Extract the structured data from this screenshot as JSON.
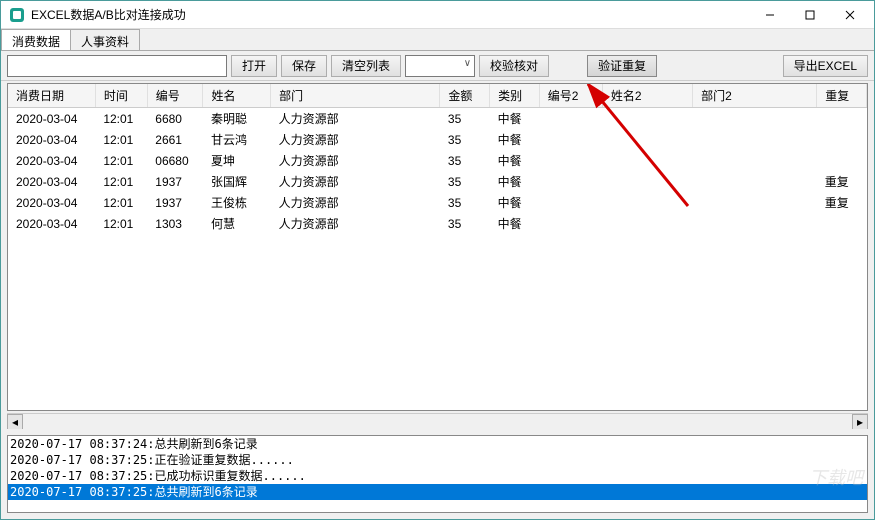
{
  "window": {
    "title": "EXCEL数据A/B比对连接成功"
  },
  "tabs": [
    {
      "label": "消费数据",
      "active": true
    },
    {
      "label": "人事资料",
      "active": false
    }
  ],
  "toolbar": {
    "open": "打开",
    "save": "保存",
    "clear_list": "清空列表",
    "combo_arrow": "∨",
    "check": "校验核对",
    "verify_dup": "验证重复",
    "export": "导出EXCEL"
  },
  "table": {
    "headers": [
      "消费日期",
      "时间",
      "编号",
      "姓名",
      "部门",
      "金额",
      "类别",
      "编号2",
      "姓名2",
      "部门2",
      "重复"
    ],
    "rows": [
      [
        "2020-03-04",
        "12:01",
        "6680",
        "秦明聪",
        "人力资源部",
        "35",
        "中餐",
        "",
        "",
        "",
        ""
      ],
      [
        "2020-03-04",
        "12:01",
        "2661",
        "甘云鸿",
        "人力资源部",
        "35",
        "中餐",
        "",
        "",
        "",
        ""
      ],
      [
        "2020-03-04",
        "12:01",
        "06680",
        "夏坤",
        "人力资源部",
        "35",
        "中餐",
        "",
        "",
        "",
        ""
      ],
      [
        "2020-03-04",
        "12:01",
        "1937",
        "张国辉",
        "人力资源部",
        "35",
        "中餐",
        "",
        "",
        "",
        "重复"
      ],
      [
        "2020-03-04",
        "12:01",
        "1937",
        "王俊栋",
        "人力资源部",
        "35",
        "中餐",
        "",
        "",
        "",
        "重复"
      ],
      [
        "2020-03-04",
        "12:01",
        "1303",
        "何慧",
        "人力资源部",
        "35",
        "中餐",
        "",
        "",
        "",
        ""
      ]
    ]
  },
  "log": [
    {
      "text": "2020-07-17 08:37:24:总共刷新到6条记录",
      "selected": false
    },
    {
      "text": "2020-07-17 08:37:25:正在验证重复数据......",
      "selected": false
    },
    {
      "text": "2020-07-17 08:37:25:已成功标识重复数据......",
      "selected": false
    },
    {
      "text": "2020-07-17 08:37:25:总共刷新到6条记录",
      "selected": true
    }
  ],
  "watermark": "下载吧"
}
